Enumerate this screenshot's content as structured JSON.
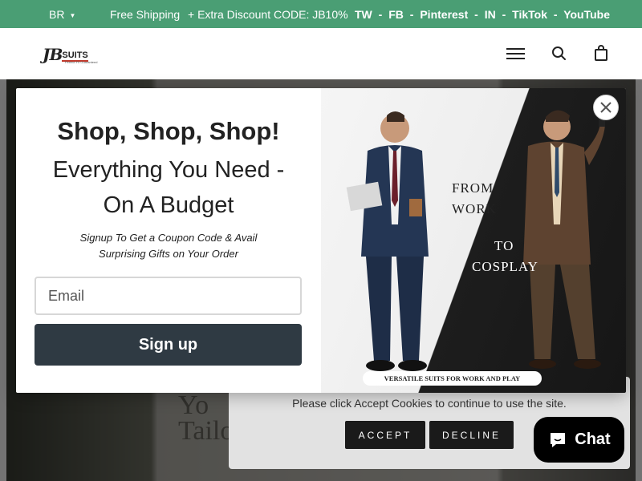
{
  "topbar": {
    "country": "BR",
    "free_shipping": "Free Shipping",
    "discount": "+ Extra Discount CODE: JB10%",
    "social": [
      "TW",
      "FB",
      "Pinterest",
      "IN",
      "TikTok",
      "YouTube"
    ],
    "separator": "-"
  },
  "header": {
    "logo_jb": "JB",
    "logo_suits": "SUITS",
    "logo_tagline": "Perfect Fit Guaranteed",
    "icons": [
      "menu-icon",
      "search-icon",
      "bag-icon"
    ]
  },
  "hero": {
    "text": "Yo\nTailo"
  },
  "popup": {
    "title": "Shop, Shop, Shop!",
    "subtitle_line1": "Everything You Need -",
    "subtitle_line2": "On A Budget",
    "desc_line1": "Signup To Get a Coupon Code & Avail",
    "desc_line2": "Surprising Gifts on Your Order",
    "email_placeholder": "Email",
    "signup_label": "Sign up",
    "image_label_work_1": "FROM",
    "image_label_work_2": "WORK",
    "image_label_cos_1": "TO",
    "image_label_cos_2": "COSPLAY",
    "ribbon": "VERSATILE SUITS FOR WORK AND PLAY"
  },
  "cookie": {
    "message": "Please click Accept Cookies to continue to use the site.",
    "accept": "ACCEPT",
    "decline": "DECLINE"
  },
  "chat": {
    "label": "Chat"
  },
  "colors": {
    "topbar": "#4a9e74",
    "signup_button": "#2f3a43",
    "cookie_buttons": "#1a1a1a"
  }
}
